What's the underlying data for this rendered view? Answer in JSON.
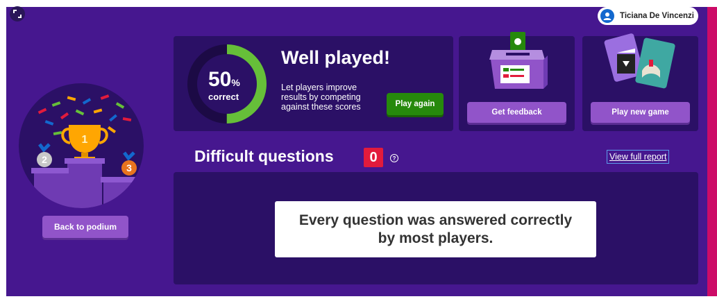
{
  "header": {
    "user_name": "Ticiana De Vincenzi",
    "fullscreen_icon": "fullscreen-icon",
    "avatar_icon": "user-icon"
  },
  "podium": {
    "ranks": [
      "1",
      "2",
      "3"
    ],
    "back_label": "Back to podium"
  },
  "score": {
    "percent_value": "50",
    "percent_sign": "%",
    "label": "correct",
    "fraction": 0.5,
    "title": "Well played!",
    "description": "Let players improve results by competing against these scores",
    "play_again_label": "Play again"
  },
  "feedback": {
    "button_label": "Get feedback"
  },
  "new_game": {
    "button_label": "Play new game"
  },
  "difficult": {
    "title": "Difficult questions",
    "count": "0",
    "help_glyph": "?",
    "view_report_label": "View full report",
    "message": "Every question was answered correctly by most players."
  },
  "colors": {
    "background": "#46178f",
    "card": "#2b1066",
    "accent_green": "#26890c",
    "ring_green": "#66bf39",
    "button_purple": "#9154c9",
    "badge_red": "#e21b3c"
  }
}
